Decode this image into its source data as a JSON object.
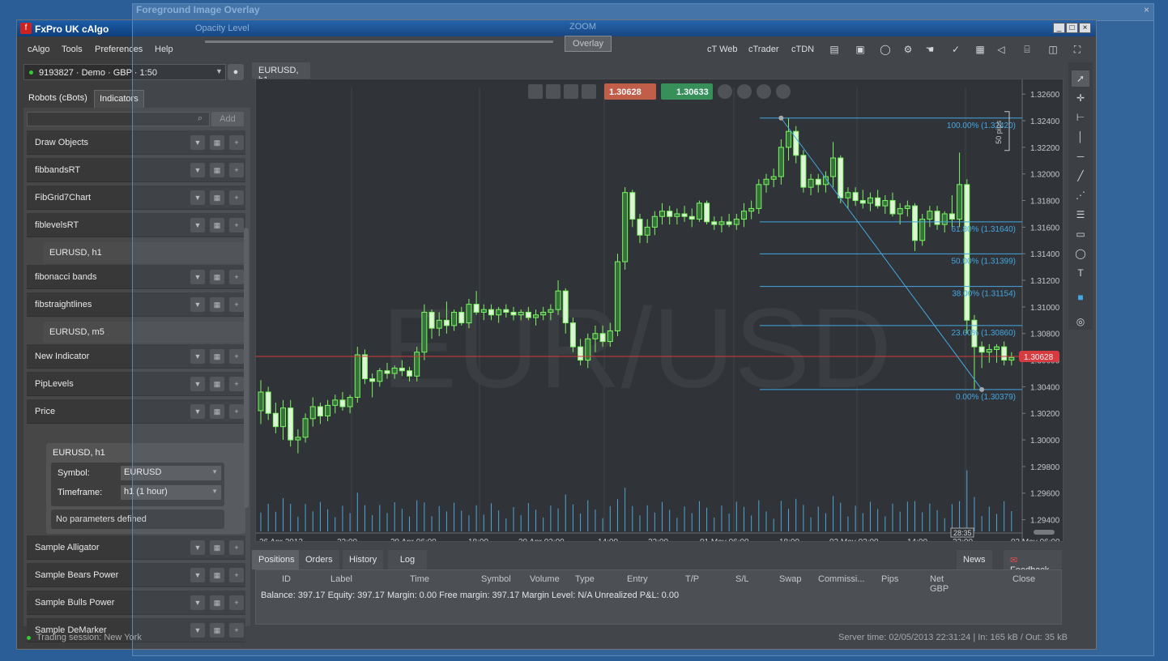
{
  "overlay": {
    "title": "Foreground Image Overlay",
    "opacity_label": "Opacity Level",
    "zoom_label": "ZOOM",
    "overlay_button": "Overlay",
    "close": "×"
  },
  "window": {
    "title": "FxPro UK cAlgo",
    "min": "_",
    "max": "□",
    "close": "×"
  },
  "menu": [
    "cAlgo",
    "Tools",
    "Preferences",
    "Help"
  ],
  "top_links": [
    "cT Web",
    "cTrader",
    "cTDN"
  ],
  "account": "9193827 · Demo · GBP · 1:50",
  "left_tabs": {
    "robots": "Robots (cBots)",
    "indicators": "Indicators"
  },
  "add_label": "Add",
  "indicators": [
    {
      "name": "Draw Objects"
    },
    {
      "name": "fibbandsRT"
    },
    {
      "name": "FibGrid7Chart"
    },
    {
      "name": "fiblevelsRT"
    },
    {
      "sub": "EURUSD, h1"
    },
    {
      "name": "fibonacci bands"
    },
    {
      "name": "fibstraightlines"
    },
    {
      "sub": "EURUSD, m5"
    },
    {
      "name": "New Indicator"
    },
    {
      "name": "PipLevels"
    },
    {
      "name": "Price"
    }
  ],
  "price_instance": {
    "title": "EURUSD, h1",
    "symbol_label": "Symbol:",
    "symbol_value": "EURUSD",
    "tf_label": "Timeframe:",
    "tf_value": "h1 (1 hour)",
    "no_params": "No parameters defined"
  },
  "indicators_after": [
    "Sample Alligator",
    "Sample Bears Power",
    "Sample Bulls Power",
    "Sample DeMarker"
  ],
  "chart": {
    "tab": "EURUSD, h1",
    "watermark": "EUR/USD",
    "sell": "1.30628",
    "buy": "1.30633",
    "current_price": "1.30628",
    "period_tag": "28:35",
    "pips_label": "50 pips",
    "y_ticks": [
      "1.32600",
      "1.32400",
      "1.32200",
      "1.32000",
      "1.31800",
      "1.31600",
      "1.31400",
      "1.31200",
      "1.31000",
      "1.30800",
      "1.30600",
      "1.30400",
      "1.30200",
      "1.30000",
      "1.29800",
      "1.29600",
      "1.29400"
    ],
    "x_ticks": [
      "26 Apr 2013",
      "22:00",
      "29 Apr 06:00",
      "18:00",
      "30 Apr 02:00",
      "14:00",
      "22:00",
      "01 May 06:00",
      "18:00",
      "02 May 02:00",
      "14:00",
      "22:00",
      "03 May 06:00"
    ],
    "fib_levels": [
      "100.00% (1.32420)",
      "61.80% (1.31640)",
      "50.00% (1.31399)",
      "38.00% (1.31154)",
      "23.60% (1.30860)",
      "0.00% (1.30379)"
    ],
    "colors": {
      "up": "#7dff5a",
      "down": "#e8ffd8",
      "fib": "#3fa9e8",
      "price_line": "#e03030",
      "volume": "#4da6d8"
    }
  },
  "chart_data": {
    "type": "candlestick",
    "symbol": "EURUSD",
    "timeframe": "h1",
    "ylim": [
      1.293,
      1.3265
    ],
    "current_price": 1.30628,
    "fibonacci": [
      {
        "level": "100.00%",
        "price": 1.3242
      },
      {
        "level": "61.80%",
        "price": 1.3164
      },
      {
        "level": "50.00%",
        "price": 1.31399
      },
      {
        "level": "38.00%",
        "price": 1.31154
      },
      {
        "level": "23.60%",
        "price": 1.3086
      },
      {
        "level": "0.00%",
        "price": 1.30379
      }
    ],
    "candles": [
      [
        1.3022,
        1.3045,
        1.3012,
        1.3036
      ],
      [
        1.3036,
        1.304,
        1.3015,
        1.302
      ],
      [
        1.302,
        1.3028,
        1.3005,
        1.301
      ],
      [
        1.301,
        1.303,
        1.3,
        1.3024
      ],
      [
        1.3024,
        1.303,
        1.2995,
        1.3
      ],
      [
        1.3,
        1.3008,
        1.299,
        1.3002
      ],
      [
        1.3002,
        1.302,
        1.2998,
        1.3016
      ],
      [
        1.3016,
        1.3032,
        1.301,
        1.3025
      ],
      [
        1.3025,
        1.3028,
        1.3012,
        1.3018
      ],
      [
        1.3018,
        1.303,
        1.3014,
        1.3026
      ],
      [
        1.3026,
        1.3034,
        1.302,
        1.303
      ],
      [
        1.303,
        1.3036,
        1.3022,
        1.3025
      ],
      [
        1.3025,
        1.3034,
        1.302,
        1.3032
      ],
      [
        1.3032,
        1.307,
        1.3028,
        1.3064
      ],
      [
        1.3064,
        1.3068,
        1.3042,
        1.3046
      ],
      [
        1.3046,
        1.305,
        1.3032,
        1.3044
      ],
      [
        1.3044,
        1.3054,
        1.304,
        1.3052
      ],
      [
        1.3052,
        1.3058,
        1.3046,
        1.305
      ],
      [
        1.305,
        1.3056,
        1.3046,
        1.3054
      ],
      [
        1.3054,
        1.306,
        1.3048,
        1.3052
      ],
      [
        1.3052,
        1.3055,
        1.3044,
        1.3048
      ],
      [
        1.3048,
        1.307,
        1.3044,
        1.3066
      ],
      [
        1.3066,
        1.3102,
        1.306,
        1.3096
      ],
      [
        1.3096,
        1.3098,
        1.3076,
        1.3084
      ],
      [
        1.3084,
        1.3096,
        1.3078,
        1.309
      ],
      [
        1.309,
        1.3104,
        1.308,
        1.3086
      ],
      [
        1.3086,
        1.3098,
        1.3082,
        1.3096
      ],
      [
        1.3096,
        1.31,
        1.3086,
        1.3088
      ],
      [
        1.3088,
        1.3106,
        1.3084,
        1.3102
      ],
      [
        1.3102,
        1.3112,
        1.3094,
        1.3096
      ],
      [
        1.3096,
        1.3102,
        1.309,
        1.3098
      ],
      [
        1.3098,
        1.3102,
        1.309,
        1.3094
      ],
      [
        1.3094,
        1.31,
        1.3088,
        1.3098
      ],
      [
        1.3098,
        1.3102,
        1.3092,
        1.3096
      ],
      [
        1.3096,
        1.31,
        1.309,
        1.3094
      ],
      [
        1.3094,
        1.3098,
        1.309,
        1.3096
      ],
      [
        1.3096,
        1.31,
        1.309,
        1.3092
      ],
      [
        1.3092,
        1.3098,
        1.3086,
        1.3094
      ],
      [
        1.3094,
        1.31,
        1.309,
        1.3096
      ],
      [
        1.3096,
        1.3102,
        1.309,
        1.3098
      ],
      [
        1.3098,
        1.312,
        1.3094,
        1.3112
      ],
      [
        1.3112,
        1.3114,
        1.308,
        1.3088
      ],
      [
        1.3088,
        1.3092,
        1.3066,
        1.307
      ],
      [
        1.307,
        1.3076,
        1.3056,
        1.306
      ],
      [
        1.306,
        1.308,
        1.3054,
        1.3076
      ],
      [
        1.3076,
        1.3086,
        1.3066,
        1.308
      ],
      [
        1.308,
        1.3086,
        1.307,
        1.3074
      ],
      [
        1.3074,
        1.3088,
        1.307,
        1.3082
      ],
      [
        1.3082,
        1.314,
        1.3078,
        1.3134
      ],
      [
        1.3134,
        1.319,
        1.3128,
        1.3186
      ],
      [
        1.3186,
        1.3188,
        1.316,
        1.3166
      ],
      [
        1.3166,
        1.317,
        1.3148,
        1.3154
      ],
      [
        1.3154,
        1.3166,
        1.3148,
        1.316
      ],
      [
        1.316,
        1.3172,
        1.3154,
        1.3168
      ],
      [
        1.3168,
        1.3178,
        1.3162,
        1.3172
      ],
      [
        1.3172,
        1.3176,
        1.3162,
        1.3168
      ],
      [
        1.3168,
        1.3174,
        1.3162,
        1.317
      ],
      [
        1.317,
        1.3176,
        1.3164,
        1.3168
      ],
      [
        1.3168,
        1.3174,
        1.316,
        1.3166
      ],
      [
        1.3166,
        1.318,
        1.3164,
        1.3178
      ],
      [
        1.3178,
        1.318,
        1.3162,
        1.3164
      ],
      [
        1.3164,
        1.3168,
        1.3158,
        1.3162
      ],
      [
        1.3162,
        1.3168,
        1.3156,
        1.3164
      ],
      [
        1.3164,
        1.317,
        1.316,
        1.3162
      ],
      [
        1.3162,
        1.317,
        1.3158,
        1.3166
      ],
      [
        1.3166,
        1.3178,
        1.316,
        1.3172
      ],
      [
        1.3172,
        1.318,
        1.3166,
        1.3174
      ],
      [
        1.3174,
        1.3196,
        1.317,
        1.3192
      ],
      [
        1.3192,
        1.32,
        1.3186,
        1.3196
      ],
      [
        1.3196,
        1.3204,
        1.319,
        1.3198
      ],
      [
        1.3198,
        1.3226,
        1.3192,
        1.322
      ],
      [
        1.322,
        1.3242,
        1.321,
        1.3232
      ],
      [
        1.3232,
        1.3236,
        1.3208,
        1.3214
      ],
      [
        1.3214,
        1.3218,
        1.3186,
        1.319
      ],
      [
        1.319,
        1.32,
        1.3184,
        1.3196
      ],
      [
        1.3196,
        1.32,
        1.3186,
        1.3192
      ],
      [
        1.3192,
        1.3202,
        1.3186,
        1.3198
      ],
      [
        1.3198,
        1.3224,
        1.319,
        1.3212
      ],
      [
        1.3212,
        1.3214,
        1.3178,
        1.3182
      ],
      [
        1.3182,
        1.319,
        1.3174,
        1.3186
      ],
      [
        1.3186,
        1.319,
        1.3176,
        1.318
      ],
      [
        1.318,
        1.3188,
        1.3174,
        1.3178
      ],
      [
        1.3178,
        1.3186,
        1.3172,
        1.3182
      ],
      [
        1.3182,
        1.3188,
        1.3174,
        1.3176
      ],
      [
        1.3176,
        1.3184,
        1.317,
        1.318
      ],
      [
        1.318,
        1.3186,
        1.3168,
        1.317
      ],
      [
        1.317,
        1.3178,
        1.3162,
        1.3174
      ],
      [
        1.3174,
        1.318,
        1.3168,
        1.3176
      ],
      [
        1.3176,
        1.3178,
        1.3142,
        1.315
      ],
      [
        1.315,
        1.317,
        1.3146,
        1.3166
      ],
      [
        1.3166,
        1.3176,
        1.316,
        1.3172
      ],
      [
        1.3172,
        1.3176,
        1.3158,
        1.3162
      ],
      [
        1.3162,
        1.3172,
        1.3156,
        1.317
      ],
      [
        1.317,
        1.3184,
        1.316,
        1.3166
      ],
      [
        1.3166,
        1.3216,
        1.316,
        1.3192
      ],
      [
        1.3192,
        1.3196,
        1.308,
        1.309
      ],
      [
        1.309,
        1.3094,
        1.3038,
        1.307
      ],
      [
        1.307,
        1.3074,
        1.3054,
        1.3066
      ],
      [
        1.3066,
        1.3072,
        1.3058,
        1.3068
      ],
      [
        1.3068,
        1.3072,
        1.3058,
        1.307
      ],
      [
        1.307,
        1.3074,
        1.3056,
        1.306
      ],
      [
        1.306,
        1.3066,
        1.3056,
        1.3062
      ]
    ]
  },
  "bottom_tabs": [
    "Positions",
    "Orders",
    "History",
    "Log"
  ],
  "right_tabs": [
    "News",
    "Feedback"
  ],
  "columns": [
    "ID",
    "Label",
    "Time",
    "Symbol",
    "Volume",
    "Type",
    "Entry",
    "T/P",
    "S/L",
    "Swap",
    "Commissi...",
    "Pips",
    "Net GBP",
    "Close"
  ],
  "summary": "Balance: 397.17   Equity: 397.17   Margin: 0.00   Free margin: 397.17   Margin Level: N/A   Unrealized P&L: 0.00",
  "status_left": "Trading session:  New York",
  "status_right": "Server time: 02/05/2013 22:31:24  |  In: 165 kB / Out: 35 kB"
}
